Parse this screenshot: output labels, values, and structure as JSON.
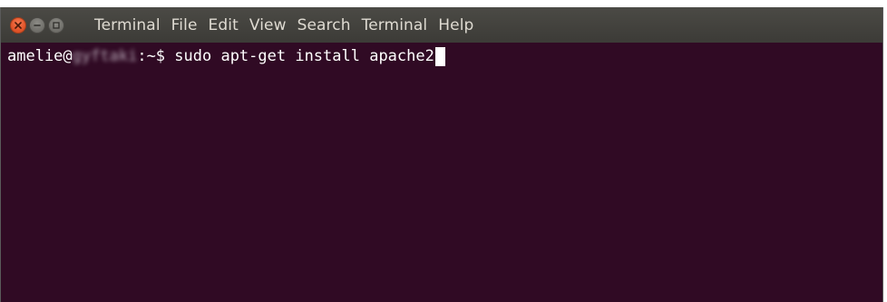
{
  "window": {
    "colors": {
      "terminal_background": "#300a24",
      "titlebar_background": "#3c3b37",
      "close_button": "#e2552a",
      "menu_text": "#dfdbd2",
      "terminal_text": "#ffffff"
    },
    "controls": {
      "close_icon": "close-icon",
      "minimize_icon": "minimize-icon",
      "maximize_icon": "maximize-icon"
    }
  },
  "menubar": {
    "items": [
      {
        "label": "Terminal"
      },
      {
        "label": "File"
      },
      {
        "label": "Edit"
      },
      {
        "label": "View"
      },
      {
        "label": "Search"
      },
      {
        "label": "Terminal"
      },
      {
        "label": "Help"
      }
    ]
  },
  "terminal": {
    "prompt": {
      "user": "amelie",
      "at": "@",
      "host": "gyftaki",
      "path": ":~$ "
    },
    "command": "sudo apt-get install apache2"
  }
}
